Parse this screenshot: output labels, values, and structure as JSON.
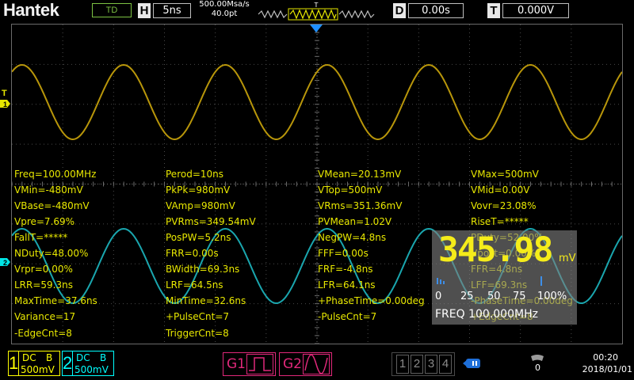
{
  "brand": "Hantek",
  "header": {
    "mode": "TD",
    "timebase_label": "H",
    "timebase_value": "5ns",
    "sample_rate": "500.00Msa/s",
    "sample_points": "40.0pt",
    "trigger_pos_marker": "T",
    "delay_label": "D",
    "delay_value": "0.00s",
    "trigger_label": "T",
    "trigger_value": "0.000V"
  },
  "markers": {
    "ch1_trigger": "T",
    "ch1_level": "1",
    "ch2_level": "2"
  },
  "measurements": [
    [
      "Freq=100.00MHz",
      "Perod=10ns",
      "VMean=20.13mV",
      "VMax=500mV"
    ],
    [
      "VMin=-480mV",
      "PkPk=980mV",
      "VTop=500mV",
      "VMid=0.00V"
    ],
    [
      "VBase=-480mV",
      "VAmp=980mV",
      "VRms=351.36mV",
      "Vovr=23.08%"
    ],
    [
      "Vpre=7.69%",
      "PVRms=349.54mV",
      "PVMean=1.02V",
      "RiseT=*****"
    ],
    [
      "FallT=*****",
      "PosPW=5.2ns",
      "NegPW=4.8ns",
      "PDuty=52.00%"
    ],
    [
      "NDuty=48.00%",
      "FRR=0.00s",
      "FFF=0.00s",
      "Vpost=0.00%"
    ],
    [
      "Vrpr=0.00%",
      "BWidth=69.3ns",
      "FRF=-4.8ns",
      "FFR=4.8ns"
    ],
    [
      "LRR=59.3ns",
      "LRF=64.5ns",
      "LFR=64.1ns",
      "LFF=69.3ns"
    ],
    [
      "MaxTime=37.6ns",
      "MinTime=32.6ns",
      "+PhaseTime=0.00deg",
      "-PhaseTime=0.00deg"
    ],
    [
      "Variance=17",
      "+PulseCnt=7",
      "-PulseCnt=7",
      "+EdgeCnt=8"
    ],
    [
      "-EdgeCnt=8",
      "TriggerCnt=8",
      "",
      ""
    ]
  ],
  "counter": {
    "value": "345.98",
    "unit": "mV",
    "scale": [
      "0",
      "25",
      "50",
      "75",
      "100%"
    ],
    "freq": "FREQ  100.000MHz"
  },
  "channels": [
    {
      "num": "1",
      "coupling": "DC",
      "bw": "B",
      "scale": "500mV",
      "color": "#ffff00"
    },
    {
      "num": "2",
      "coupling": "DC",
      "bw": "B",
      "scale": "500mV",
      "color": "#00ffff"
    }
  ],
  "generators": [
    {
      "label": "G1",
      "wave": "square-wave-icon"
    },
    {
      "label": "G2",
      "wave": "sine-wave-icon"
    }
  ],
  "pages": [
    "1",
    "2",
    "3",
    "4"
  ],
  "status": {
    "time": "00:20",
    "date": "2018/01/01",
    "badge": "0"
  },
  "colors": {
    "ch1_trace": "#b8960a",
    "ch2_trace": "#1aa6ae",
    "ch1_text": "#e6e600",
    "ch2_text": "#00e6e6",
    "counter_digits": "#f5ec1a",
    "generator": "#e0287a",
    "trigger_marker": "#1e90ff"
  }
}
